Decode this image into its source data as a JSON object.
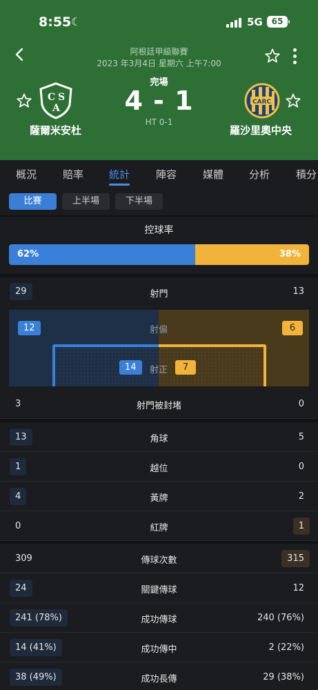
{
  "status_bar": {
    "time": "8:55",
    "network": "5G",
    "battery": "65"
  },
  "match": {
    "league": "阿根廷甲級聯賽",
    "datetime": "2023 年3月4日 星期六 上午7:00",
    "status": "完場",
    "score": "4 - 1",
    "halftime": "HT 0-1",
    "home": {
      "name": "薩爾米安杜",
      "logo_text": "CSA"
    },
    "away": {
      "name": "羅沙里奧中央",
      "logo_text": "CARC"
    }
  },
  "tabs": [
    "概況",
    "賠率",
    "統計",
    "陣容",
    "媒體",
    "分析",
    "積分"
  ],
  "active_tab": "統計",
  "subtabs": [
    "比賽",
    "上半場",
    "下半場"
  ],
  "active_subtab": "比賽",
  "possession": {
    "title": "控球率",
    "home": "62%",
    "away": "38%",
    "home_pct": 62,
    "away_pct": 38
  },
  "shots": {
    "total": {
      "label": "射門",
      "home": "29",
      "away": "13"
    },
    "off_target": {
      "label": "射偏",
      "home": "12",
      "away": "6"
    },
    "on_target": {
      "label": "射正",
      "home": "14",
      "away": "7"
    }
  },
  "stats": [
    {
      "label": "射門被封堵",
      "home": "3",
      "away": "0",
      "hl": "none"
    },
    {
      "label": "角球",
      "home": "13",
      "away": "5",
      "hl": "home"
    },
    {
      "label": "越位",
      "home": "1",
      "away": "0",
      "hl": "home"
    },
    {
      "label": "黃牌",
      "home": "4",
      "away": "2",
      "hl": "home"
    },
    {
      "label": "紅牌",
      "home": "0",
      "away": "1",
      "hl": "away"
    },
    {
      "label": "傳球次數",
      "home": "309",
      "away": "315",
      "hl": "away"
    },
    {
      "label": "關鍵傳球",
      "home": "24",
      "away": "12",
      "hl": "home"
    },
    {
      "label": "成功傳球",
      "home": "241 (78%)",
      "away": "240 (76%)",
      "hl": "home"
    },
    {
      "label": "成功傳中",
      "home": "14 (41%)",
      "away": "2 (22%)",
      "hl": "home"
    },
    {
      "label": "成功長傳",
      "home": "38 (49%)",
      "away": "29 (38%)",
      "hl": "home"
    }
  ],
  "colors": {
    "header": "#2e6f35",
    "home": "#3a80d8",
    "away": "#f2b33b",
    "accent": "#4a8fe6"
  }
}
